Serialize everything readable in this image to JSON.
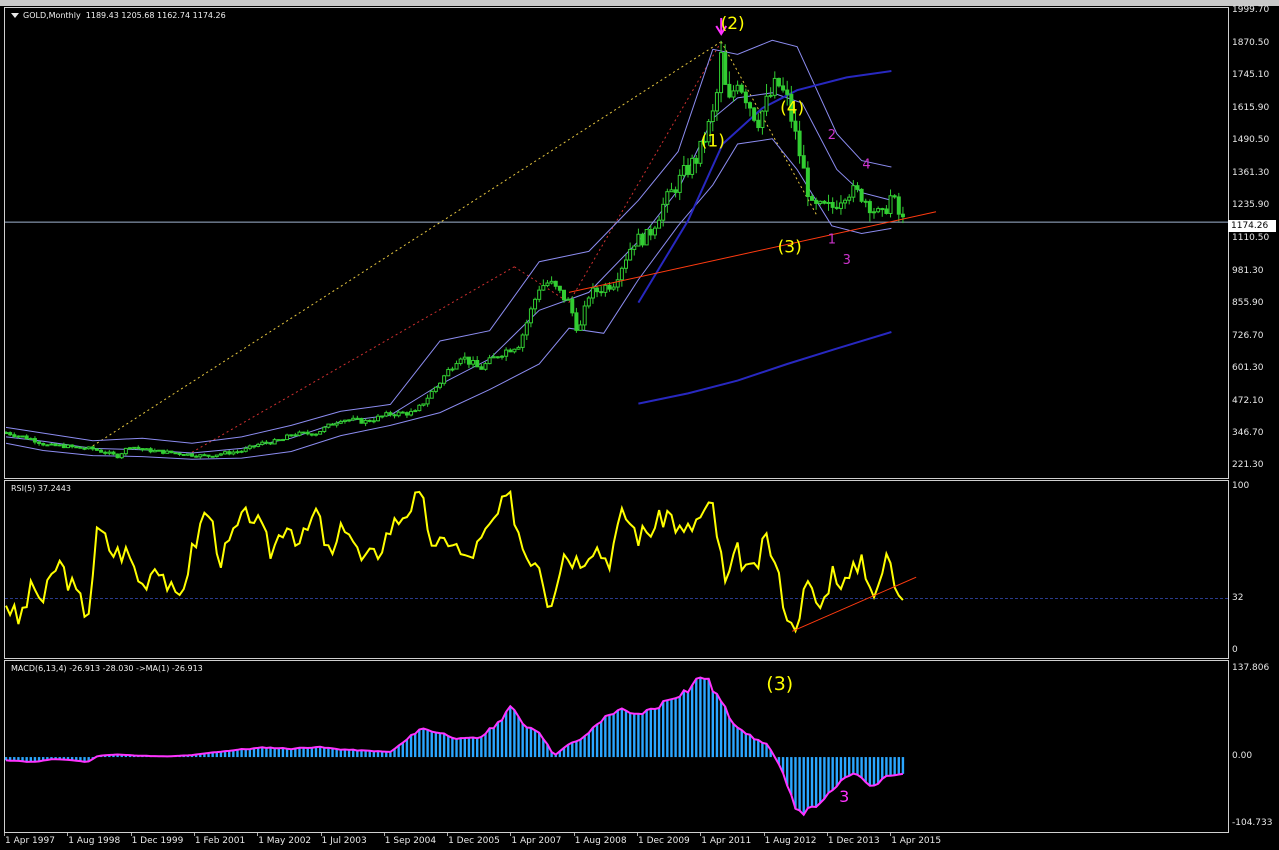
{
  "chart_data": [
    {
      "type": "candlestick",
      "title": "GOLD,Monthly",
      "ohlc_readout": "1189.43 1205.68 1162.74 1174.26",
      "current_price": "1174.26",
      "ylim": [
        221.3,
        1999.7
      ],
      "y_ticks": [
        "1999.70",
        "1870.50",
        "1745.10",
        "1615.90",
        "1490.50",
        "1361.30",
        "1235.90",
        "1110.50",
        "981.30",
        "855.90",
        "726.70",
        "601.30",
        "472.10",
        "346.70",
        "221.30"
      ],
      "y_tick_values": [
        1999.7,
        1870.5,
        1745.1,
        1615.9,
        1490.5,
        1361.3,
        1235.9,
        1110.5,
        981.3,
        855.9,
        726.7,
        601.3,
        472.1,
        346.7,
        221.3
      ],
      "x_ticks": [
        "1 Apr 1997",
        "1 Aug 1998",
        "1 Dec 1999",
        "1 Feb 2001",
        "1 May 2002",
        "1 Jul 2003",
        "1 Sep 2004",
        "1 Dec 2005",
        "1 Apr 2007",
        "1 Aug 2008",
        "1 Dec 2009",
        "1 Apr 2011",
        "1 Aug 2012",
        "1 Dec 2013",
        "1 Apr 2015"
      ],
      "close_path": [
        [
          1997.25,
          352
        ],
        [
          1997.5,
          340
        ],
        [
          1997.8,
          325
        ],
        [
          1998.1,
          300
        ],
        [
          1998.4,
          300
        ],
        [
          1998.7,
          292
        ],
        [
          1999.0,
          288
        ],
        [
          1999.5,
          260
        ],
        [
          1999.75,
          300
        ],
        [
          2000.0,
          285
        ],
        [
          2000.5,
          275
        ],
        [
          2001.0,
          265
        ],
        [
          2001.3,
          260
        ],
        [
          2001.6,
          270
        ],
        [
          2002.0,
          280
        ],
        [
          2002.4,
          310
        ],
        [
          2002.8,
          320
        ],
        [
          2003.0,
          345
        ],
        [
          2003.5,
          350
        ],
        [
          2004.0,
          405
        ],
        [
          2004.5,
          395
        ],
        [
          2005.0,
          425
        ],
        [
          2005.5,
          430
        ],
        [
          2006.0,
          550
        ],
        [
          2006.4,
          655
        ],
        [
          2006.8,
          600
        ],
        [
          2007.2,
          660
        ],
        [
          2007.6,
          700
        ],
        [
          2008.0,
          920
        ],
        [
          2008.2,
          940
        ],
        [
          2008.6,
          860
        ],
        [
          2008.8,
          740
        ],
        [
          2009.0,
          890
        ],
        [
          2009.5,
          940
        ],
        [
          2009.9,
          1100
        ],
        [
          2010.2,
          1120
        ],
        [
          2010.5,
          1240
        ],
        [
          2010.9,
          1360
        ],
        [
          2011.2,
          1430
        ],
        [
          2011.55,
          1620
        ],
        [
          2011.67,
          1820
        ],
        [
          2011.8,
          1620
        ],
        [
          2012.0,
          1740
        ],
        [
          2012.4,
          1570
        ],
        [
          2012.8,
          1720
        ],
        [
          2013.0,
          1650
        ],
        [
          2013.3,
          1400
        ],
        [
          2013.5,
          1230
        ],
        [
          2013.9,
          1230
        ],
        [
          2014.2,
          1300
        ],
        [
          2014.5,
          1280
        ],
        [
          2014.9,
          1190
        ],
        [
          2015.1,
          1280
        ],
        [
          2015.3,
          1180
        ]
      ],
      "series": [
        {
          "name": "Bollinger upper",
          "values": [
            [
              1997.25,
              372
            ],
            [
              1998.0,
              350
            ],
            [
              1999.0,
              320
            ],
            [
              2000.0,
              330
            ],
            [
              2001.0,
              310
            ],
            [
              2002.0,
              335
            ],
            [
              2003.0,
              380
            ],
            [
              2004.0,
              435
            ],
            [
              2005.0,
              462
            ],
            [
              2006.0,
              710
            ],
            [
              2007.0,
              750
            ],
            [
              2008.0,
              1020
            ],
            [
              2009.0,
              1060
            ],
            [
              2010.0,
              1260
            ],
            [
              2010.8,
              1450
            ],
            [
              2011.5,
              1850
            ],
            [
              2012.0,
              1830
            ],
            [
              2012.7,
              1885
            ],
            [
              2013.2,
              1860
            ],
            [
              2014.0,
              1520
            ],
            [
              2014.5,
              1415
            ],
            [
              2015.1,
              1390
            ]
          ]
        },
        {
          "name": "Bollinger middle",
          "values": [
            [
              1997.25,
              335
            ],
            [
              1998.0,
              318
            ],
            [
              1999.0,
              290
            ],
            [
              2000.0,
              285
            ],
            [
              2001.0,
              272
            ],
            [
              2002.0,
              290
            ],
            [
              2003.0,
              330
            ],
            [
              2004.0,
              395
            ],
            [
              2005.0,
              420
            ],
            [
              2006.0,
              540
            ],
            [
              2007.0,
              640
            ],
            [
              2008.0,
              830
            ],
            [
              2009.0,
              900
            ],
            [
              2010.0,
              1100
            ],
            [
              2010.8,
              1300
            ],
            [
              2011.5,
              1580
            ],
            [
              2012.0,
              1660
            ],
            [
              2012.7,
              1680
            ],
            [
              2013.3,
              1640
            ],
            [
              2014.0,
              1380
            ],
            [
              2014.5,
              1290
            ],
            [
              2015.1,
              1260
            ]
          ]
        },
        {
          "name": "Bollinger lower",
          "values": [
            [
              1997.25,
              310
            ],
            [
              1998.0,
              282
            ],
            [
              1999.0,
              262
            ],
            [
              2000.0,
              258
            ],
            [
              2001.0,
              248
            ],
            [
              2002.0,
              252
            ],
            [
              2003.0,
              278
            ],
            [
              2004.0,
              340
            ],
            [
              2005.0,
              380
            ],
            [
              2006.0,
              430
            ],
            [
              2007.0,
              520
            ],
            [
              2008.0,
              620
            ],
            [
              2008.6,
              760
            ],
            [
              2009.3,
              740
            ],
            [
              2010.0,
              950
            ],
            [
              2010.8,
              1160
            ],
            [
              2011.5,
              1320
            ],
            [
              2012.0,
              1480
            ],
            [
              2012.7,
              1500
            ],
            [
              2013.2,
              1380
            ],
            [
              2013.9,
              1160
            ],
            [
              2014.5,
              1130
            ],
            [
              2015.1,
              1150
            ]
          ]
        },
        {
          "name": "MA 1",
          "values": [
            [
              2010.0,
              860
            ],
            [
              2011.0,
              1180
            ],
            [
              2011.7,
              1480
            ],
            [
              2012.5,
              1620
            ],
            [
              2013.2,
              1690
            ],
            [
              2014.2,
              1740
            ],
            [
              2015.1,
              1765
            ]
          ]
        },
        {
          "name": "MA 2",
          "values": [
            [
              2010.0,
              465
            ],
            [
              2011.0,
              505
            ],
            [
              2012.0,
              555
            ],
            [
              2013.0,
              620
            ],
            [
              2014.0,
              680
            ],
            [
              2015.1,
              745
            ]
          ]
        }
      ],
      "annotations": [
        {
          "text": "(2)",
          "x": 2011.9,
          "y": 1930
        },
        {
          "text": "(1)",
          "x": 2011.5,
          "y": 1470
        },
        {
          "text": "(4)",
          "x": 2013.1,
          "y": 1600
        },
        {
          "text": "(3)",
          "x": 2013.05,
          "y": 1055
        },
        {
          "text": "2",
          "x": 2013.9,
          "y": 1500
        },
        {
          "text": "4",
          "x": 2014.6,
          "y": 1385
        },
        {
          "text": "1",
          "x": 2013.9,
          "y": 1090
        },
        {
          "text": "3",
          "x": 2014.2,
          "y": 1010
        }
      ]
    },
    {
      "type": "line",
      "title": "RSI(5) 37.2443",
      "ylim": [
        0,
        100
      ],
      "y_ticks": [
        "100",
        "32",
        "0"
      ],
      "y_tick_values": [
        100,
        32,
        0
      ],
      "reference_level": 32,
      "values": [
        [
          1997.25,
          30
        ],
        [
          1997.5,
          18
        ],
        [
          1997.8,
          40
        ],
        [
          1998.0,
          30
        ],
        [
          1998.3,
          55
        ],
        [
          1998.6,
          38
        ],
        [
          1998.9,
          22
        ],
        [
          1999.1,
          75
        ],
        [
          1999.4,
          60
        ],
        [
          1999.7,
          60
        ],
        [
          2000.0,
          40
        ],
        [
          2000.3,
          55
        ],
        [
          2000.7,
          28
        ],
        [
          2001.0,
          60
        ],
        [
          2001.3,
          88
        ],
        [
          2001.6,
          55
        ],
        [
          2001.9,
          75
        ],
        [
          2002.2,
          85
        ],
        [
          2002.6,
          60
        ],
        [
          2002.9,
          80
        ],
        [
          2003.2,
          65
        ],
        [
          2003.5,
          85
        ],
        [
          2003.8,
          55
        ],
        [
          2004.1,
          80
        ],
        [
          2004.4,
          55
        ],
        [
          2004.7,
          58
        ],
        [
          2005.0,
          75
        ],
        [
          2005.3,
          85
        ],
        [
          2005.6,
          95
        ],
        [
          2005.9,
          60
        ],
        [
          2006.2,
          70
        ],
        [
          2006.5,
          55
        ],
        [
          2006.8,
          65
        ],
        [
          2007.1,
          80
        ],
        [
          2007.4,
          95
        ],
        [
          2007.7,
          60
        ],
        [
          2008.0,
          55
        ],
        [
          2008.2,
          28
        ],
        [
          2008.5,
          60
        ],
        [
          2008.8,
          55
        ],
        [
          2009.1,
          65
        ],
        [
          2009.4,
          55
        ],
        [
          2009.7,
          85
        ],
        [
          2010.0,
          70
        ],
        [
          2010.3,
          75
        ],
        [
          2010.6,
          85
        ],
        [
          2010.9,
          70
        ],
        [
          2011.2,
          80
        ],
        [
          2011.5,
          88
        ],
        [
          2011.75,
          40
        ],
        [
          2012.0,
          60
        ],
        [
          2012.3,
          45
        ],
        [
          2012.6,
          70
        ],
        [
          2012.9,
          35
        ],
        [
          2013.1,
          12
        ],
        [
          2013.4,
          40
        ],
        [
          2013.7,
          25
        ],
        [
          2013.9,
          50
        ],
        [
          2014.2,
          40
        ],
        [
          2014.5,
          58
        ],
        [
          2014.8,
          30
        ],
        [
          2015.0,
          60
        ],
        [
          2015.2,
          38
        ],
        [
          2015.3,
          37.2443
        ]
      ],
      "trendline": [
        [
          2013.1,
          12
        ],
        [
          2015.6,
          45
        ]
      ]
    },
    {
      "type": "histogram",
      "title": "MACD(6,13,4) -26.913 -28.030  ->MA(1) -26.913",
      "ylim": [
        -104.733,
        137.806
      ],
      "y_ticks": [
        "137.806",
        "0.00",
        "-104.733"
      ],
      "y_tick_values": [
        137.806,
        0,
        -104.733
      ],
      "values": [
        [
          1997.25,
          -5
        ],
        [
          1997.8,
          -8
        ],
        [
          1998.2,
          -3
        ],
        [
          1998.6,
          -5
        ],
        [
          1998.9,
          -8
        ],
        [
          1999.1,
          2
        ],
        [
          1999.5,
          4
        ],
        [
          2000.0,
          2
        ],
        [
          2000.5,
          1
        ],
        [
          2001.0,
          3
        ],
        [
          2001.5,
          8
        ],
        [
          2002.0,
          12
        ],
        [
          2002.5,
          15
        ],
        [
          2003.0,
          13
        ],
        [
          2003.5,
          16
        ],
        [
          2004.0,
          12
        ],
        [
          2004.5,
          10
        ],
        [
          2005.0,
          8
        ],
        [
          2005.3,
          25
        ],
        [
          2005.6,
          45
        ],
        [
          2006.0,
          38
        ],
        [
          2006.4,
          28
        ],
        [
          2006.8,
          30
        ],
        [
          2007.2,
          55
        ],
        [
          2007.4,
          80
        ],
        [
          2007.7,
          50
        ],
        [
          2008.0,
          40
        ],
        [
          2008.3,
          2
        ],
        [
          2008.6,
          20
        ],
        [
          2008.9,
          30
        ],
        [
          2009.2,
          55
        ],
        [
          2009.6,
          75
        ],
        [
          2009.9,
          65
        ],
        [
          2010.3,
          75
        ],
        [
          2010.7,
          95
        ],
        [
          2011.0,
          105
        ],
        [
          2011.3,
          130
        ],
        [
          2011.6,
          95
        ],
        [
          2011.9,
          55
        ],
        [
          2012.3,
          30
        ],
        [
          2012.6,
          20
        ],
        [
          2012.9,
          -20
        ],
        [
          2013.2,
          -90
        ],
        [
          2013.5,
          -80
        ],
        [
          2013.8,
          -60
        ],
        [
          2014.1,
          -35
        ],
        [
          2014.4,
          -25
        ],
        [
          2014.7,
          -50
        ],
        [
          2015.0,
          -30
        ],
        [
          2015.3,
          -26.913
        ]
      ],
      "annotations": [
        {
          "text": "(3)",
          "x": 2012.85,
          "y": 105
        },
        {
          "text": "3",
          "x": 2014.15,
          "y": -70
        }
      ]
    }
  ],
  "colors": {
    "background": "#000000",
    "candle": "#32cd32",
    "bollinger": "#8c8cf0",
    "ma": "#2828c0",
    "rsi": "#ffff00",
    "macd_bar": "#2aa6ff",
    "macd_signal": "#ff33ff",
    "wave_label": "#ffff00",
    "sub_wave_label": "#cc33cc",
    "trendline": "#ff3b10",
    "price_line": "#a0b4d0"
  }
}
